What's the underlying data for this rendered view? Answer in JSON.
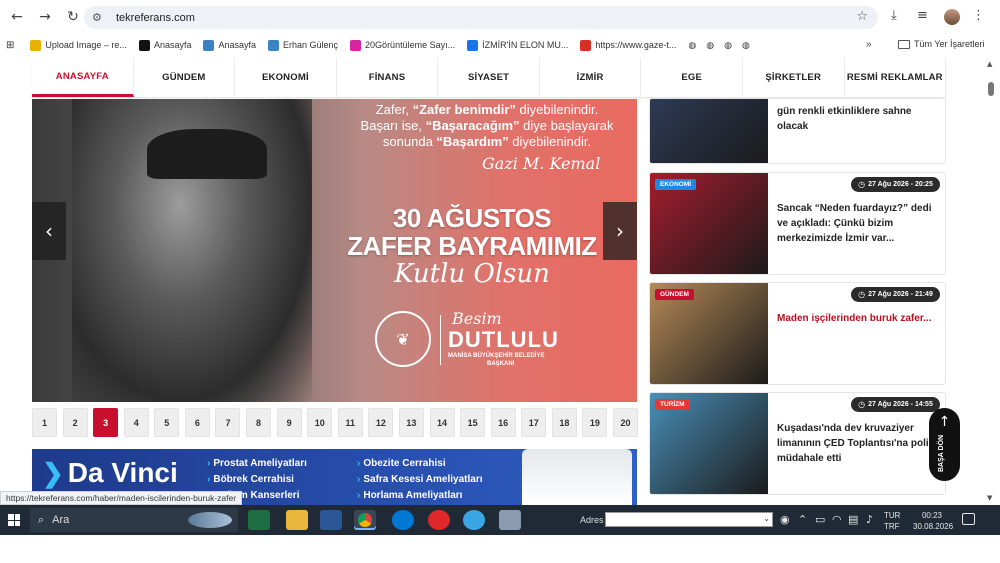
{
  "browser": {
    "url": "tekreferans.com",
    "bookmarks": [
      {
        "label": "Upload Image – re...",
        "color": "#e7b100"
      },
      {
        "label": "Anasayfa",
        "color": "#111111"
      },
      {
        "label": "Anasayfa",
        "color": "#3b82c4"
      },
      {
        "label": "Erhan Gülenç",
        "color": "#3b82c4"
      },
      {
        "label": "20Görüntüleme Sayı...",
        "color": "#d6249f"
      },
      {
        "label": "İZMİR'İN ELON MU...",
        "color": "#1a73e8"
      },
      {
        "label": "https://www.gaze-t...",
        "color": "#d93025"
      }
    ],
    "bookmarks_more": "»",
    "all_bookmarks": "Tüm Yer İşaretleri",
    "status_url": "https://tekreferans.com/haber/maden-iscilerinden-buruk-zafer"
  },
  "nav": {
    "items": [
      "ANASAYFA",
      "GÜNDEM",
      "EKONOMİ",
      "FİNANS",
      "SİYASET",
      "İZMİR",
      "EGE",
      "ŞİRKETLER",
      "RESMİ REKLAMLAR"
    ],
    "active_index": 0
  },
  "slider": {
    "quote_line1_a": "Zafer, ",
    "quote_line1_b": "“Zafer benimdir”",
    "quote_line1_c": " diyebilenindir.",
    "quote_line2_a": "Başarı ise, ",
    "quote_line2_b": "“Başaracağım”",
    "quote_line2_c": " diye başlayarak",
    "quote_line3_a": "sonunda ",
    "quote_line3_b": "“Başardım”",
    "quote_line3_c": " diyebilenindir.",
    "title_line1": "30 AĞUSTOS",
    "title_line2": "ZAFER BAYRAMIMIZ",
    "subtitle": "Kutlu Olsun",
    "mayor_first": "Besim",
    "mayor_last": "DUTLULU",
    "mayor_sub1": "MANİSA BÜYÜKŞEHİR BELEDİYE",
    "mayor_sub2": "BAŞKANI",
    "prev_icon": "‹",
    "next_icon": "›"
  },
  "pager": {
    "pages": [
      "1",
      "2",
      "3",
      "4",
      "5",
      "6",
      "7",
      "8",
      "9",
      "10",
      "11",
      "12",
      "13",
      "14",
      "15",
      "16",
      "17",
      "18",
      "19",
      "20"
    ],
    "active_index": 2
  },
  "ad": {
    "brand": "Da Vinci",
    "services": [
      "Prostat Ameliyatları",
      "Obezite Cerrahisi",
      "Böbrek Cerrahisi",
      "Safra Kesesi Ameliyatları",
      "Doğum Kanserleri",
      "Horlama Ameliyatları"
    ]
  },
  "cards": [
    {
      "category": "",
      "date": "",
      "title": "gün renkli etkinliklere sahne olacak",
      "title_color": "normal",
      "thumb_color": "#2e3a55"
    },
    {
      "category": "EKONOMİ",
      "cat_color": "#1e88e5",
      "date": "27 Ağu 2026 - 20:25",
      "title": "Sancak “Neden fuardayız?” dedi ve açıkladı: Çünkü bizim merkezimizde İzmir var...",
      "title_color": "normal",
      "thumb_color": "#a51d2d"
    },
    {
      "category": "GÜNDEM",
      "cat_color": "#c8102e",
      "date": "27 Ağu 2026 - 21:49",
      "title": "Maden işçilerinden buruk zafer...",
      "title_color": "red",
      "thumb_color": "#b58a57"
    },
    {
      "category": "TURİZM",
      "cat_color": "#e53935",
      "date": "27 Ağu 2026 - 14:55",
      "title": "Kuşadası'nda dev kruvaziyer limanının ÇED Toplantısı'na polis müdahale etti",
      "title_color": "normal",
      "thumb_color": "#4a8fb8"
    }
  ],
  "backtop": {
    "label": "BAŞA DÖN",
    "icon": "↑"
  },
  "taskbar": {
    "search_placeholder": "Ara",
    "address_label": "Adres",
    "lang1": "TUR",
    "lang2": "TRF",
    "time": "00:23",
    "date": "30.08.2026"
  }
}
